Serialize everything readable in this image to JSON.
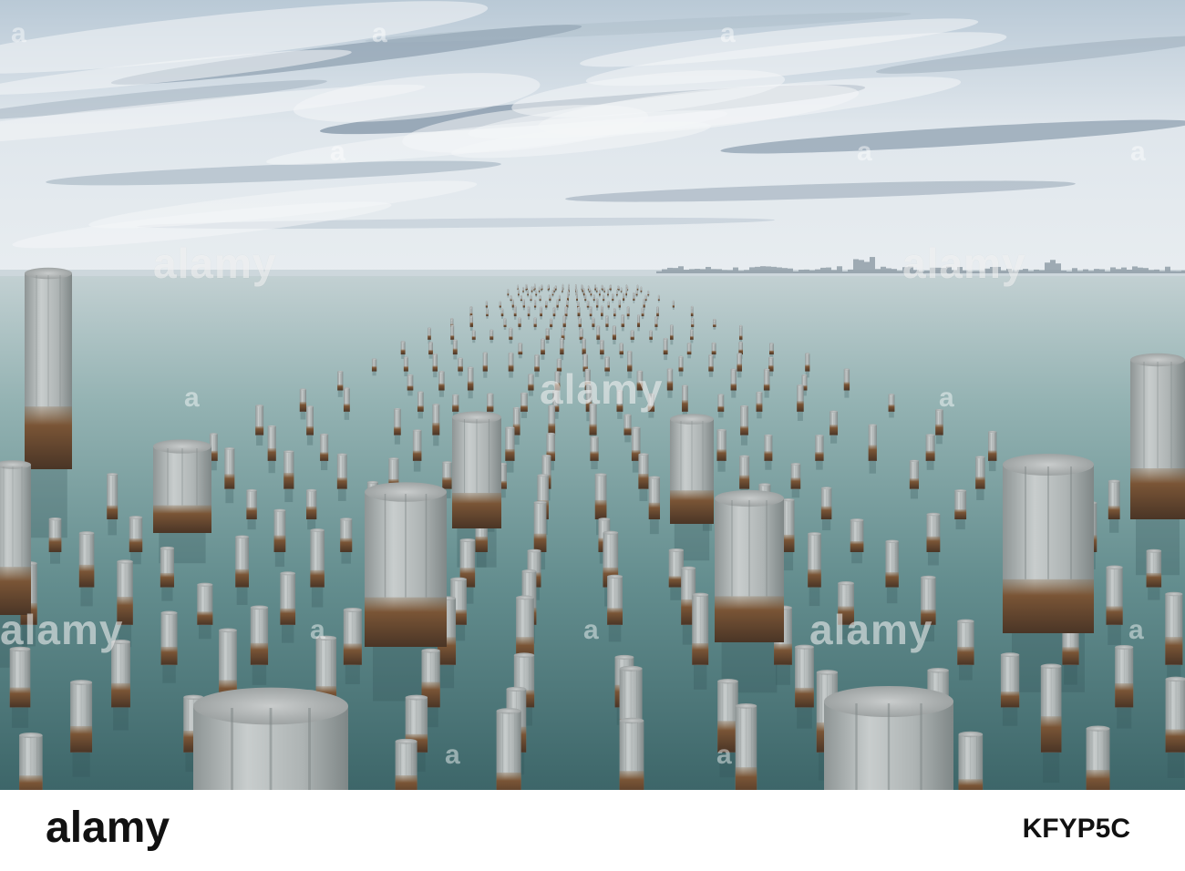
{
  "photo": {
    "subject": "wooden-pier-pylons-in-calm-water",
    "colors": {
      "sky_top": "#c9d6e0",
      "sky_mid": "#e9eef2",
      "cloud": "#6f8599",
      "horizon": "#cfd9de",
      "water_far": "#b7c9cc",
      "water_mid": "#7fa3a3",
      "water_near": "#3f6b6e",
      "pylon_top": "#cfd3d3",
      "pylon_mid": "#a9aeae",
      "pylon_stain": "#7a5a3c",
      "pylon_base": "#4a3a2c"
    }
  },
  "watermark": {
    "text": "alamy",
    "symbol": "a"
  },
  "footer": {
    "logo": "alamy",
    "image_id": "KFYP5C"
  }
}
